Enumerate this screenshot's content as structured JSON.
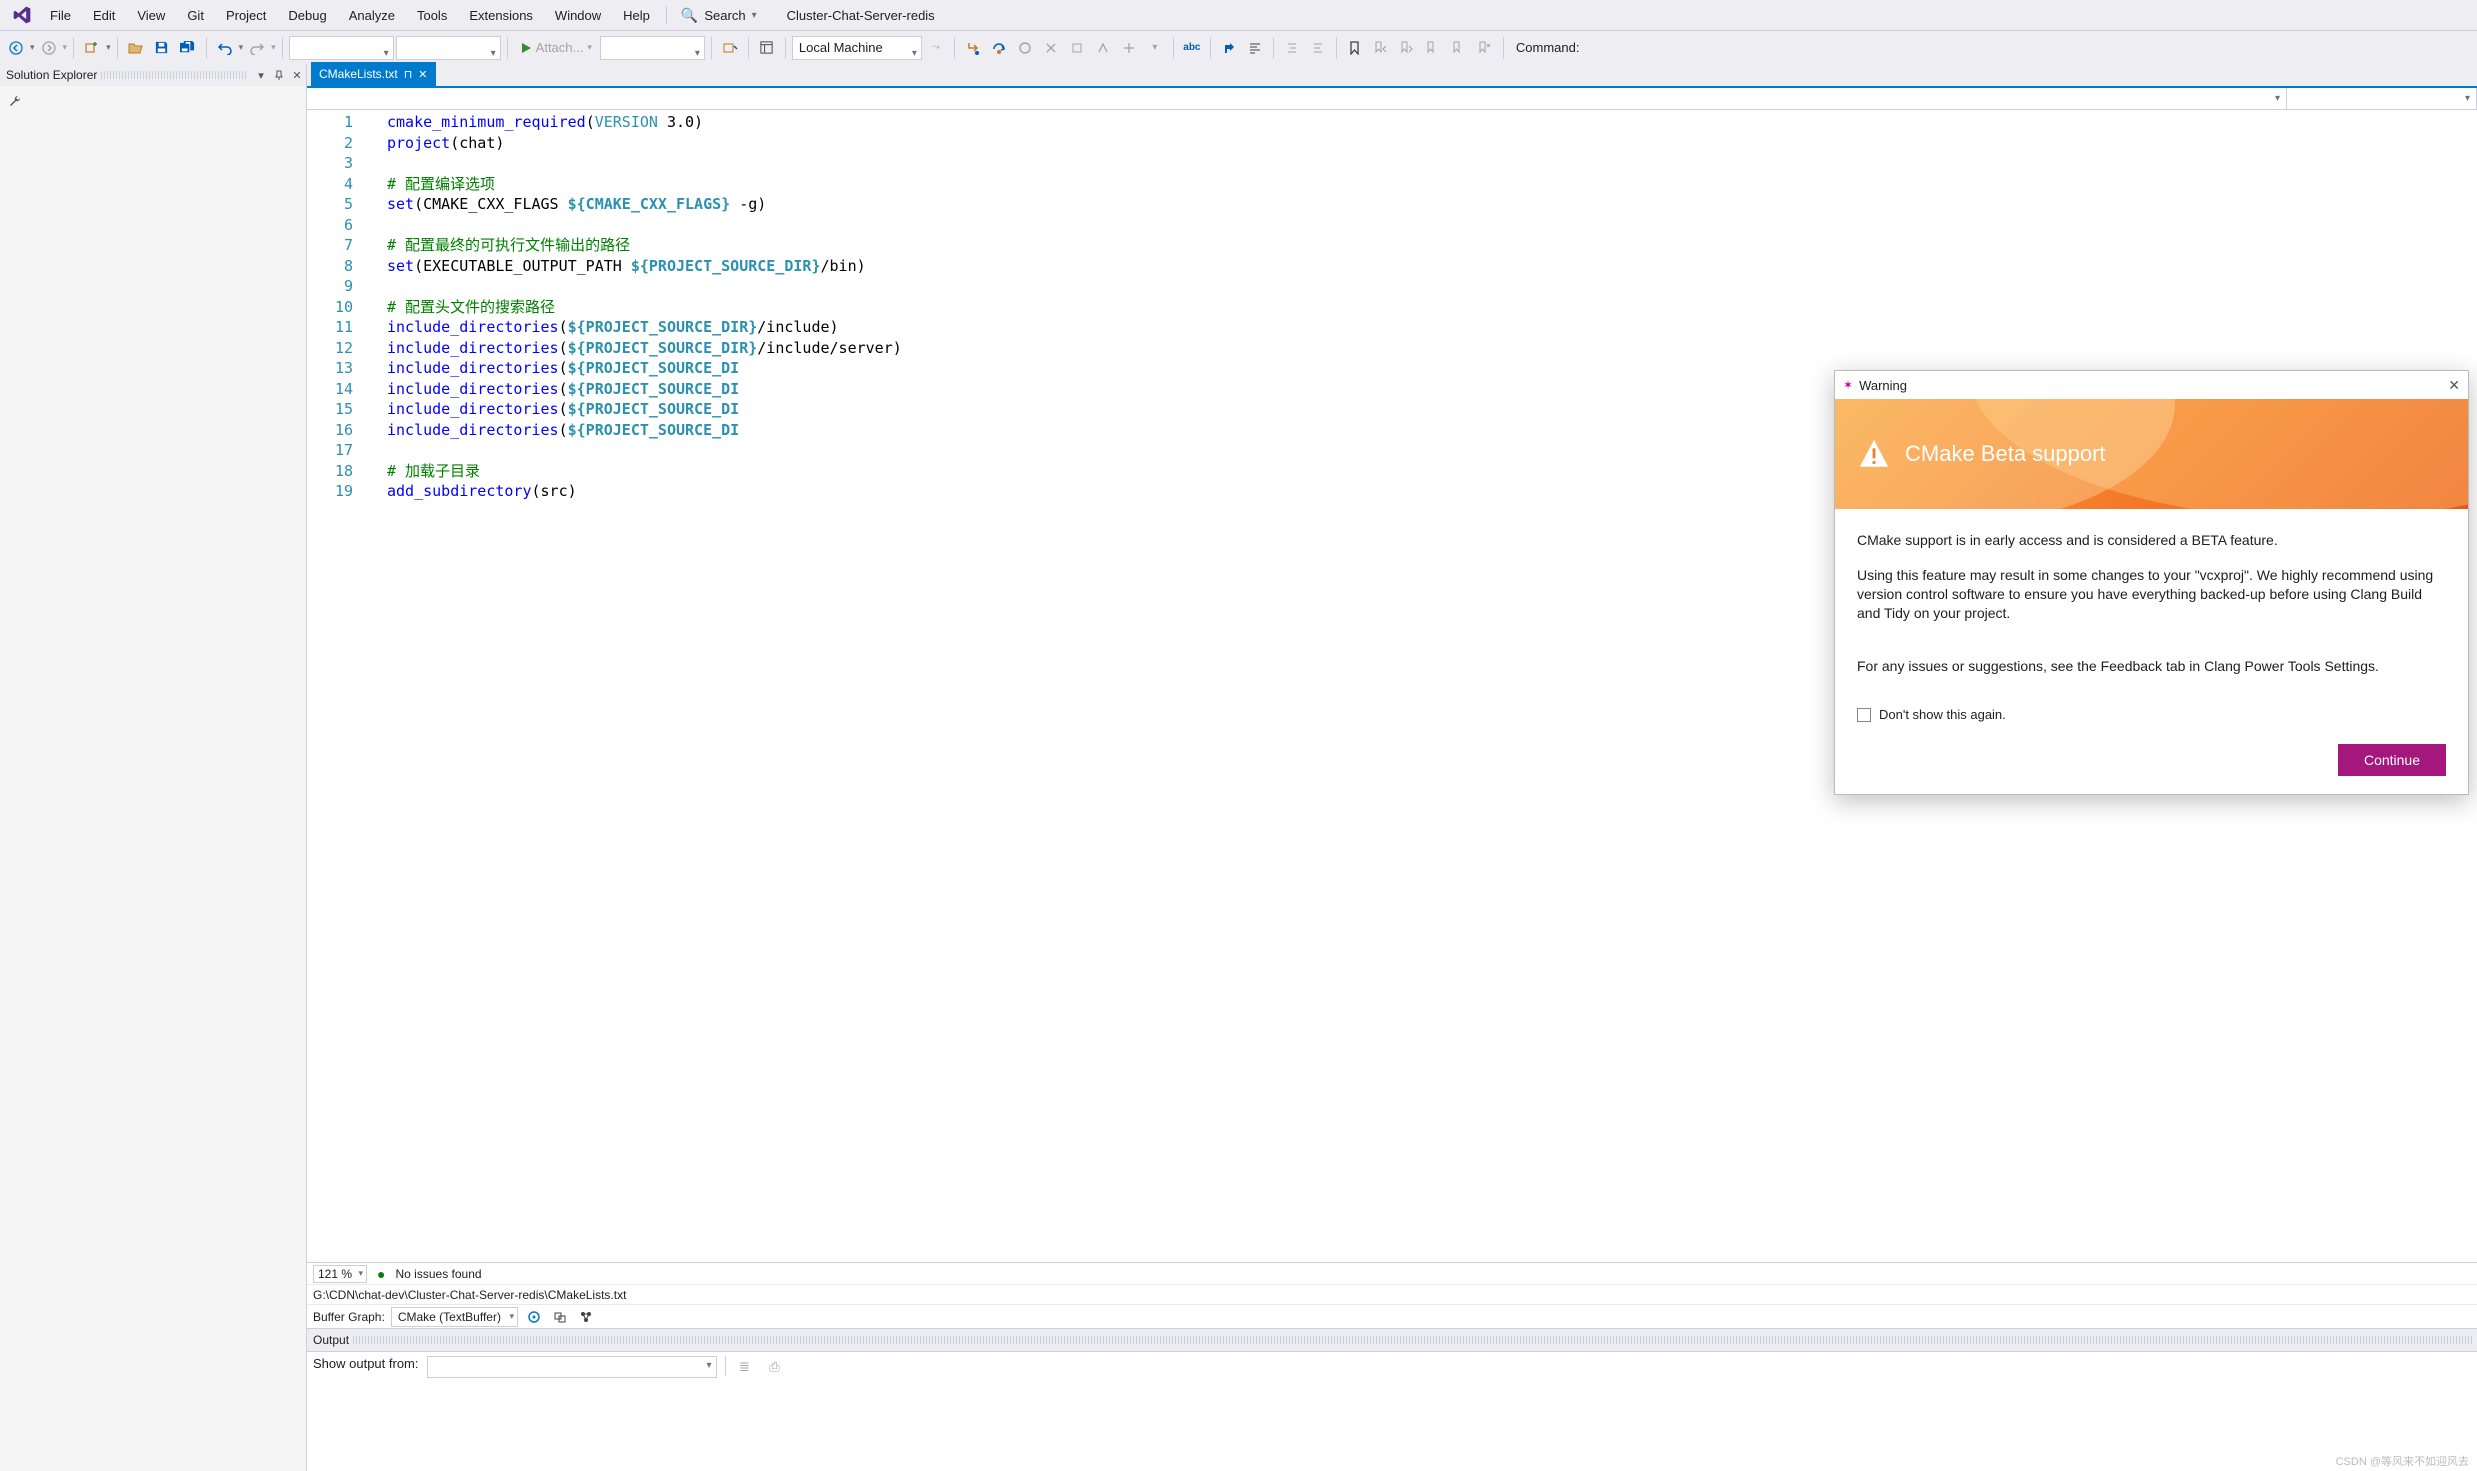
{
  "menu": {
    "file": "File",
    "edit": "Edit",
    "view": "View",
    "git": "Git",
    "project": "Project",
    "debug": "Debug",
    "analyze": "Analyze",
    "tools": "Tools",
    "extensions": "Extensions",
    "window": "Window",
    "help": "Help"
  },
  "search_label": "Search",
  "solution_name": "Cluster-Chat-Server-redis",
  "toolbar": {
    "attach_label": "Attach...",
    "local_machine": "Local Machine",
    "command_label": "Command:"
  },
  "sol_exp": {
    "title": "Solution Explorer"
  },
  "tab": {
    "filename": "CMakeLists.txt"
  },
  "code_lines": [
    [
      [
        "k-blue",
        "cmake_minimum_required"
      ],
      [
        "k-black",
        "("
      ],
      [
        "k-teal",
        "VERSION"
      ],
      [
        "k-black",
        " 3.0)"
      ]
    ],
    [
      [
        "k-blue",
        "project"
      ],
      [
        "k-black",
        "(chat)"
      ]
    ],
    [
      [
        "",
        ""
      ]
    ],
    [
      [
        "k-green",
        "# 配置编译选项"
      ]
    ],
    [
      [
        "k-blue",
        "set"
      ],
      [
        "k-black",
        "(CMAKE_CXX_FLAGS "
      ],
      [
        "k-teal k-bold",
        "${CMAKE_CXX_FLAGS}"
      ],
      [
        "k-black",
        " -g)"
      ]
    ],
    [
      [
        "",
        ""
      ]
    ],
    [
      [
        "k-green",
        "# 配置最终的可执行文件输出的路径"
      ]
    ],
    [
      [
        "k-blue",
        "set"
      ],
      [
        "k-black",
        "(EXECUTABLE_OUTPUT_PATH "
      ],
      [
        "k-teal k-bold",
        "${PROJECT_SOURCE_DIR}"
      ],
      [
        "k-black",
        "/bin)"
      ]
    ],
    [
      [
        "",
        ""
      ]
    ],
    [
      [
        "k-green",
        "# 配置头文件的搜索路径"
      ]
    ],
    [
      [
        "k-blue",
        "include_directories"
      ],
      [
        "k-black",
        "("
      ],
      [
        "k-teal k-bold",
        "${PROJECT_SOURCE_DIR}"
      ],
      [
        "k-black",
        "/include)"
      ]
    ],
    [
      [
        "k-blue",
        "include_directories"
      ],
      [
        "k-black",
        "("
      ],
      [
        "k-teal k-bold",
        "${PROJECT_SOURCE_DIR}"
      ],
      [
        "k-black",
        "/include/server)"
      ]
    ],
    [
      [
        "k-blue",
        "include_directories"
      ],
      [
        "k-black",
        "("
      ],
      [
        "k-teal k-bold",
        "${PROJECT_SOURCE_DI"
      ]
    ],
    [
      [
        "k-blue",
        "include_directories"
      ],
      [
        "k-black",
        "("
      ],
      [
        "k-teal k-bold",
        "${PROJECT_SOURCE_DI"
      ]
    ],
    [
      [
        "k-blue",
        "include_directories"
      ],
      [
        "k-black",
        "("
      ],
      [
        "k-teal k-bold",
        "${PROJECT_SOURCE_DI"
      ]
    ],
    [
      [
        "k-blue",
        "include_directories"
      ],
      [
        "k-black",
        "("
      ],
      [
        "k-teal k-bold",
        "${PROJECT_SOURCE_DI"
      ]
    ],
    [
      [
        "",
        ""
      ]
    ],
    [
      [
        "k-green",
        "# 加载子目录"
      ]
    ],
    [
      [
        "k-blue",
        "add_subdirectory"
      ],
      [
        "k-black",
        "(src)"
      ]
    ]
  ],
  "editor_status": {
    "zoom": "121 %",
    "issues": "No issues found"
  },
  "file_path": "G:\\CDN\\chat-dev\\Cluster-Chat-Server-redis\\CMakeLists.txt",
  "buffer": {
    "label": "Buffer Graph:",
    "value": "CMake (TextBuffer)"
  },
  "output": {
    "title": "Output",
    "from_label": "Show output from:"
  },
  "modal": {
    "title": "Warning",
    "heading": "CMake Beta support",
    "p1": "CMake support is in early access and is considered a BETA feature.",
    "p2": "Using this feature may result in some changes to your \"vcxproj\". We highly recommend using version control software to ensure you have everything backed-up before using Clang Build and Tidy on your project.",
    "p3": "For any issues or suggestions, see the Feedback tab in Clang Power Tools Settings.",
    "chk": "Don't show this again.",
    "continue": "Continue"
  },
  "watermark": "CSDN @等风来不如迎风去"
}
